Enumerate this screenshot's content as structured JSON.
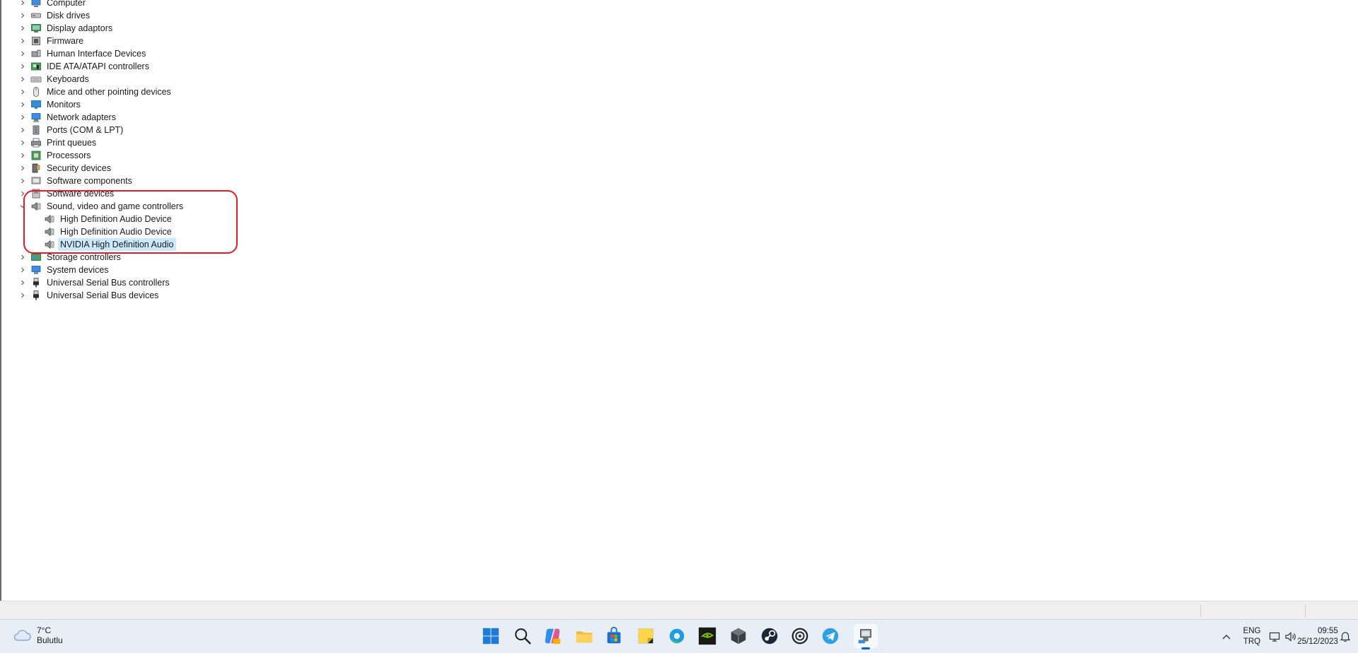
{
  "device_tree": {
    "nodes": [
      {
        "label": "Computer",
        "icon": "computer-icon",
        "expanded": false
      },
      {
        "label": "Disk drives",
        "icon": "disk-drive-icon",
        "expanded": false
      },
      {
        "label": "Display adaptors",
        "icon": "display-adapter-icon",
        "expanded": false
      },
      {
        "label": "Firmware",
        "icon": "firmware-icon",
        "expanded": false
      },
      {
        "label": "Human Interface Devices",
        "icon": "hid-icon",
        "expanded": false
      },
      {
        "label": "IDE ATA/ATAPI controllers",
        "icon": "ide-controller-icon",
        "expanded": false
      },
      {
        "label": "Keyboards",
        "icon": "keyboard-icon",
        "expanded": false
      },
      {
        "label": "Mice and other pointing devices",
        "icon": "mouse-icon",
        "expanded": false
      },
      {
        "label": "Monitors",
        "icon": "monitor-icon",
        "expanded": false
      },
      {
        "label": "Network adapters",
        "icon": "network-adapter-icon",
        "expanded": false
      },
      {
        "label": "Ports (COM & LPT)",
        "icon": "port-icon",
        "expanded": false
      },
      {
        "label": "Print queues",
        "icon": "printer-icon",
        "expanded": false
      },
      {
        "label": "Processors",
        "icon": "processor-icon",
        "expanded": false
      },
      {
        "label": "Security devices",
        "icon": "security-device-icon",
        "expanded": false
      },
      {
        "label": "Software components",
        "icon": "software-component-icon",
        "expanded": false
      },
      {
        "label": "Software devices",
        "icon": "software-device-icon",
        "expanded": false
      },
      {
        "label": "Sound, video and game controllers",
        "icon": "speaker-icon",
        "expanded": true,
        "children": [
          {
            "label": "High Definition Audio Device",
            "icon": "speaker-icon",
            "selected": false
          },
          {
            "label": "High Definition Audio Device",
            "icon": "speaker-icon",
            "selected": false
          },
          {
            "label": "NVIDIA High Definition Audio",
            "icon": "speaker-icon",
            "selected": true
          }
        ]
      },
      {
        "label": "Storage controllers",
        "icon": "storage-controller-icon",
        "expanded": false
      },
      {
        "label": "System devices",
        "icon": "system-device-icon",
        "expanded": false
      },
      {
        "label": "Universal Serial Bus controllers",
        "icon": "usb-icon",
        "expanded": false
      },
      {
        "label": "Universal Serial Bus devices",
        "icon": "usb-icon",
        "expanded": false
      }
    ]
  },
  "colors": {
    "selection": "#cce8ff",
    "highlight_ring": "#e21b2b",
    "taskbar": "#e8eef6",
    "accent": "#0067c0"
  },
  "taskbar": {
    "weather": {
      "temp": "7°C",
      "condition": "Bulutlu",
      "icon": "cloud-icon"
    },
    "apps": [
      {
        "name": "start",
        "icon": "windows-start-icon"
      },
      {
        "name": "search",
        "icon": "search-icon"
      },
      {
        "name": "copilot",
        "icon": "copilot-icon"
      },
      {
        "name": "file-explorer",
        "icon": "folder-icon"
      },
      {
        "name": "microsoft-store",
        "icon": "store-icon"
      },
      {
        "name": "sticky-notes",
        "icon": "sticky-note-icon"
      },
      {
        "name": "edge",
        "icon": "edge-icon"
      },
      {
        "name": "nvidia",
        "icon": "nvidia-icon"
      },
      {
        "name": "app-cube",
        "icon": "cube-icon"
      },
      {
        "name": "steam",
        "icon": "steam-icon"
      },
      {
        "name": "ubisoft",
        "icon": "swirl-icon"
      },
      {
        "name": "telegram",
        "icon": "telegram-icon"
      },
      {
        "name": "device-manager",
        "icon": "device-manager-icon",
        "active": true
      }
    ],
    "tray": {
      "language_top": "ENG",
      "language_bottom": "TRQ",
      "time": "09:55",
      "date": "25/12/2023"
    }
  }
}
